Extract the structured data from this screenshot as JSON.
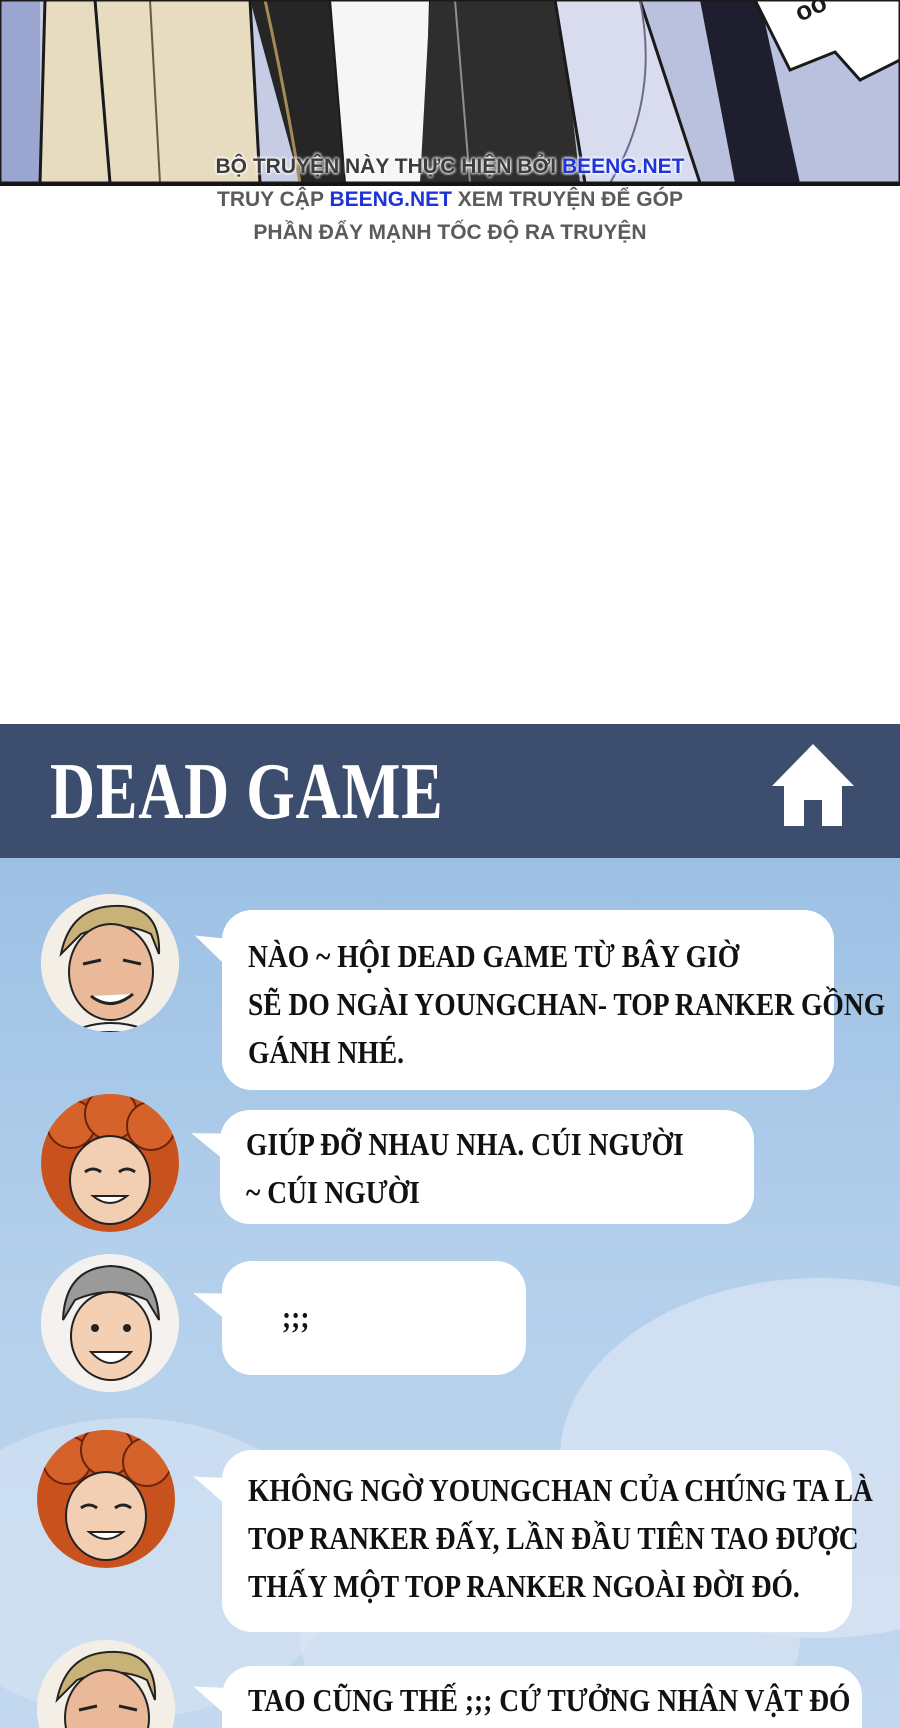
{
  "credit": {
    "line1_prefix": "BỘ TRUYỆN NÀY THỰC HIỆN BỞI ",
    "line1_site": "BEENG.NET",
    "line2_prefix": "TRUY CẬP ",
    "line2_site": "BEENG.NET",
    "line2_suffix": " XEM TRUYỆN ĐỂ GÓP",
    "line3": "PHẦN ĐẨY MẠNH TỐC ĐỘ RA TRUYỆN"
  },
  "chat": {
    "title": "DEAD GAME",
    "home_icon": "home-icon",
    "header_color": "#3d4d6e",
    "messages": [
      {
        "avatar": "slick-haired-man-avatar",
        "lines": [
          "NÀO ~ HỘI DEAD GAME TỪ BÂY GIỜ",
          "SẼ DO NGÀI YOUNGCHAN- TOP RANKER GỒNG",
          "GÁNH NHÉ."
        ]
      },
      {
        "avatar": "curly-red-hair-avatar",
        "lines": [
          "GIÚP ĐỠ NHAU NHA. CÚI NGƯỜI",
          "~ CÚI NGƯỜI"
        ]
      },
      {
        "avatar": "gray-hair-boy-avatar",
        "lines": [
          ";;;"
        ]
      },
      {
        "avatar": "curly-red-hair-avatar",
        "lines": [
          "KHÔNG NGỜ YOUNGCHAN CỦA CHÚNG TA LÀ",
          "TOP RANKER ĐẤY, LẦN ĐẦU TIÊN TAO ĐƯỢC",
          "THẤY MỘT TOP RANKER NGOÀI ĐỜI ĐÓ."
        ]
      },
      {
        "avatar": "slick-haired-man-avatar",
        "lines": [
          "TAO CŨNG THẾ ;;; CỨ TƯỞNG NHÂN VẬT ĐÓ"
        ]
      }
    ]
  }
}
